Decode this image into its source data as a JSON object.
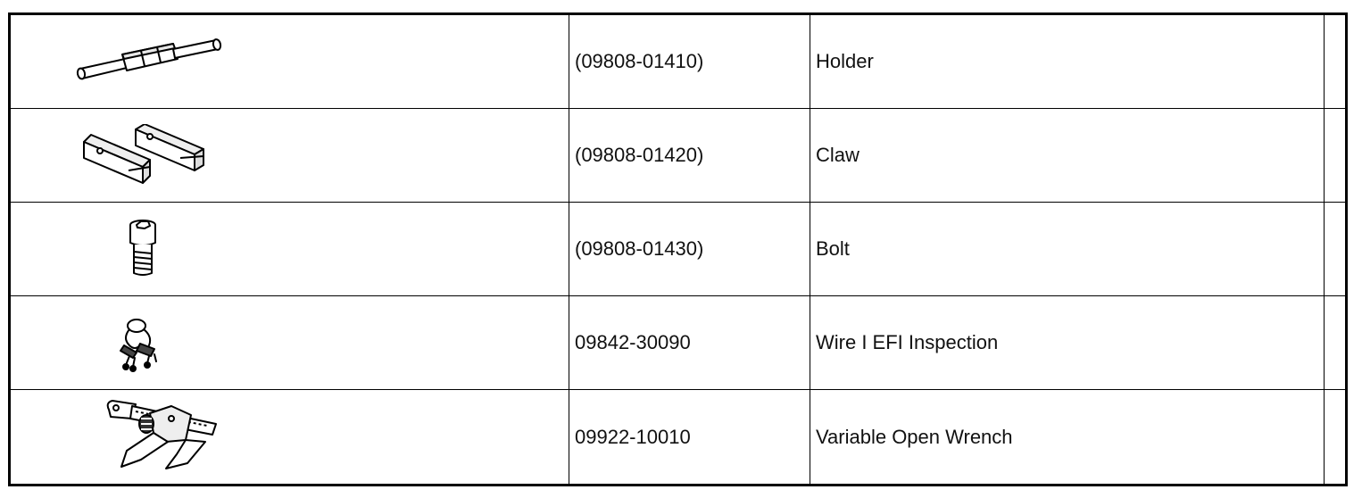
{
  "rows": [
    {
      "icon": "holder-tool-icon",
      "part_number": "(09808-01410)",
      "description": "Holder"
    },
    {
      "icon": "claw-tool-icon",
      "part_number": "(09808-01420)",
      "description": "Claw"
    },
    {
      "icon": "bolt-icon",
      "part_number": "(09808-01430)",
      "description": "Bolt"
    },
    {
      "icon": "wire-connector-icon",
      "part_number": "09842-30090",
      "description": "Wire I EFI Inspection"
    },
    {
      "icon": "open-wrench-icon",
      "part_number": "09922-10010",
      "description": "Variable Open Wrench"
    }
  ]
}
